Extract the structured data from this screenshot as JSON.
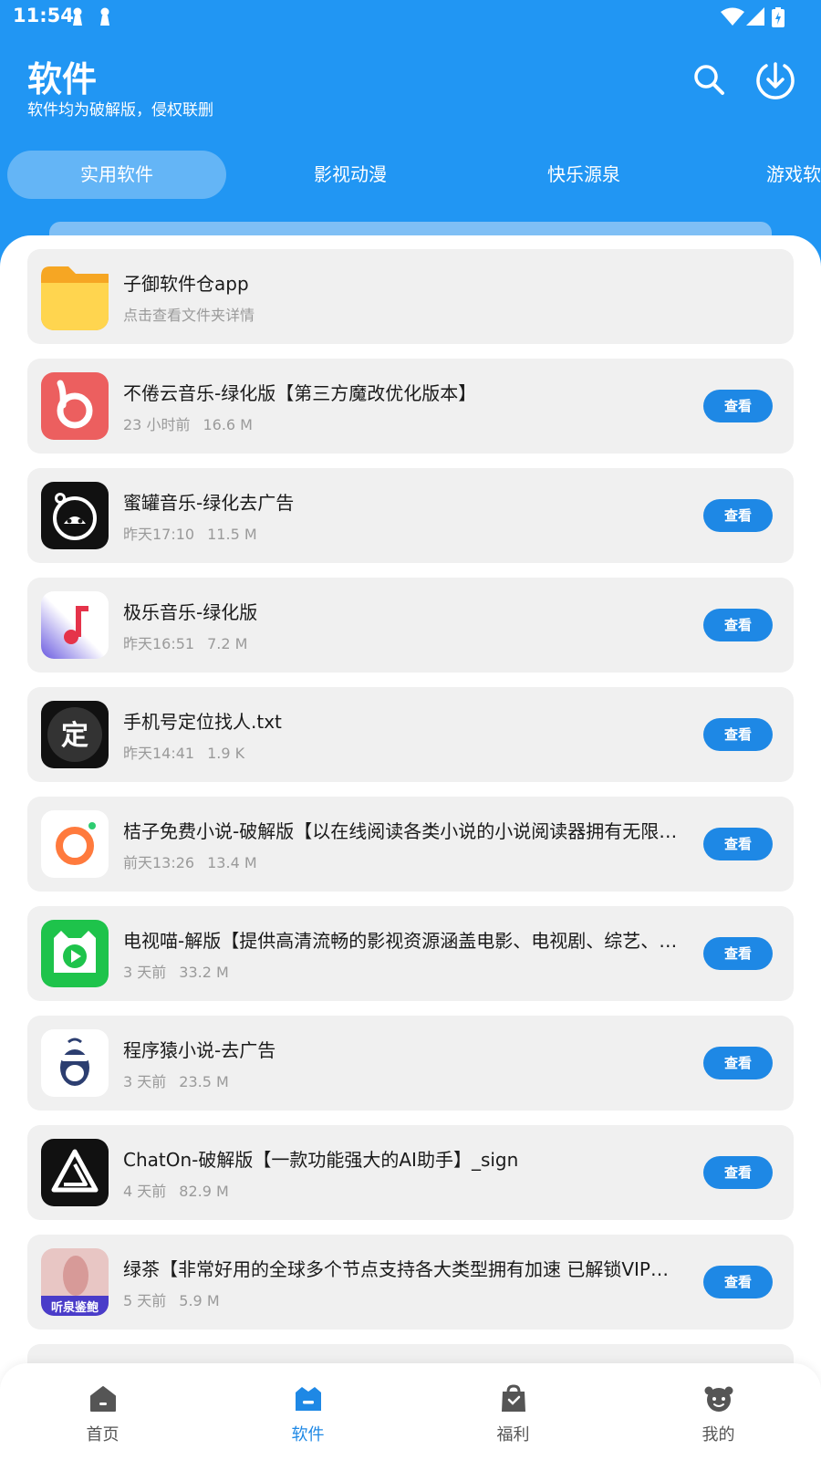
{
  "status_bar": {
    "time": "11:54"
  },
  "header": {
    "title": "软件",
    "subtitle": "软件均为破解版，侵权联删"
  },
  "tabs": [
    {
      "label": "实用软件",
      "active": true
    },
    {
      "label": "影视动漫",
      "active": false
    },
    {
      "label": "快乐源泉",
      "active": false
    },
    {
      "label": "游戏软件",
      "active": false
    }
  ],
  "items": [
    {
      "title": "子御软件仓app",
      "subtitle": "点击查看文件夹详情",
      "time": "",
      "size": "",
      "button": "",
      "icon": "folder-icon"
    },
    {
      "title": "不倦云音乐-绿化版【第三方魔改优化版本】",
      "time": "23 小时前",
      "size": "16.6 M",
      "button": "查看",
      "icon": "music-b-app-icon"
    },
    {
      "title": "蜜罐音乐-绿化去广告",
      "time": "昨天17:10",
      "size": "11.5 M",
      "button": "查看",
      "icon": "cat-headphones-app-icon"
    },
    {
      "title": "极乐音乐-绿化版",
      "time": "昨天16:51",
      "size": "7.2 M",
      "button": "查看",
      "icon": "music-note-app-icon"
    },
    {
      "title": "手机号定位找人.txt",
      "time": "昨天14:41",
      "size": "1.9 K",
      "button": "查看",
      "icon": "ding-text-app-icon"
    },
    {
      "title": "桔子免费小说-破解版【以在线阅读各类小说的小说阅读器拥有无限畅读】",
      "time": "前天13:26",
      "size": "13.4 M",
      "button": "查看",
      "icon": "orange-ring-app-icon"
    },
    {
      "title": "电视喵-解版【提供高清流畅的影视资源涵盖电影、电视剧、综艺、动漫】",
      "time": "3 天前",
      "size": "33.2 M",
      "button": "查看",
      "icon": "tv-cat-app-icon"
    },
    {
      "title": "程序猿小说-去广告",
      "time": "3 天前",
      "size": "23.5 M",
      "button": "查看",
      "icon": "monkey-app-icon"
    },
    {
      "title": "ChatOn-破解版【一款功能强大的AI助手】_sign",
      "time": "4 天前",
      "size": "82.9 M",
      "button": "查看",
      "icon": "chaton-app-icon"
    },
    {
      "title": "绿茶【非常好用的全球多个节点支持各大类型拥有加速 已解锁VIP会员】",
      "time": "5 天前",
      "size": "5.9 M",
      "button": "查看",
      "icon": "photo-app-icon",
      "icon_text": "听泉鉴鲍"
    }
  ],
  "bottom_nav": [
    {
      "label": "首页",
      "icon": "home-icon",
      "active": false
    },
    {
      "label": "软件",
      "icon": "software-box-icon",
      "active": true
    },
    {
      "label": "福利",
      "icon": "gift-bag-icon",
      "active": false
    },
    {
      "label": "我的",
      "icon": "profile-icon",
      "active": false
    }
  ],
  "colors": {
    "primary": "#2196f3",
    "button": "#1e88e5",
    "card_bg": "#f0f0f0",
    "meta_text": "#9a9a9a"
  }
}
